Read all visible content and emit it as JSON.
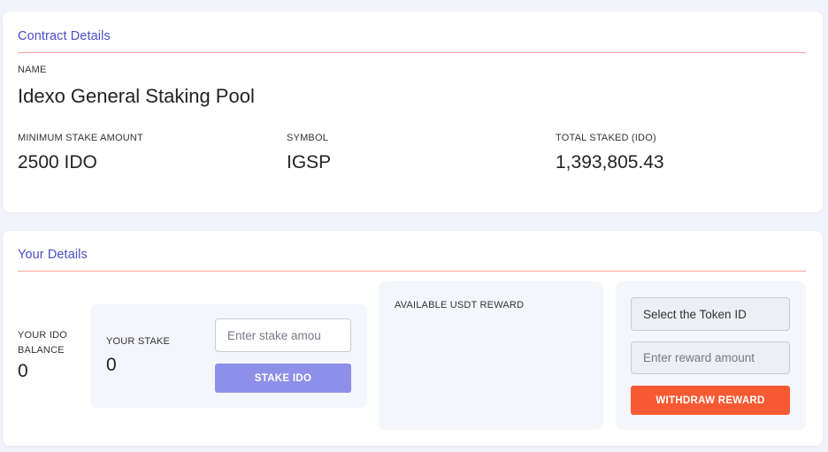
{
  "contract": {
    "title": "Contract Details",
    "name_label": "NAME",
    "name_value": "Idexo General Staking Pool",
    "min_stake_label": "MINIMUM STAKE AMOUNT",
    "min_stake_value": "2500 IDO",
    "symbol_label": "SYMBOL",
    "symbol_value": "IGSP",
    "total_staked_label": "TOTAL STAKED (IDO)",
    "total_staked_value": "1,393,805.43"
  },
  "your": {
    "title": "Your Details",
    "balance_label_line1": "YOUR IDO",
    "balance_label_line2": "BALANCE",
    "balance_value": "0",
    "stake_label": "YOUR STAKE",
    "stake_value": "0",
    "stake_input_placeholder": "Enter stake amou",
    "stake_button": "STAKE IDO",
    "reward_label": "AVAILABLE USDT REWARD",
    "token_select_value": "Select the Token ID",
    "reward_input_placeholder": "Enter reward amount",
    "withdraw_button": "WITHDRAW REWARD"
  },
  "colors": {
    "accent": "#4a4ec8",
    "divider": "#f0a694",
    "stake_button": "#8e8fe8",
    "withdraw_button": "#f75a33"
  }
}
